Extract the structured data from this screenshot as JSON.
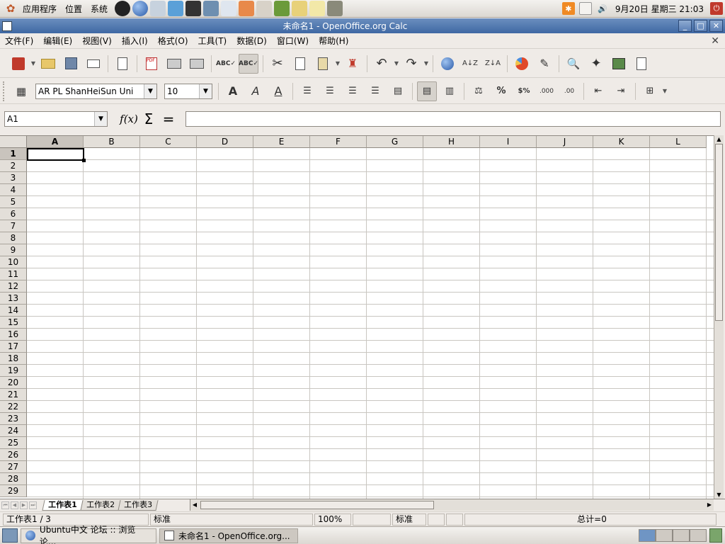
{
  "top_panel": {
    "menus": [
      "应用程序",
      "位置",
      "系统"
    ],
    "clock": "9月20日 星期三 21:03"
  },
  "window": {
    "title": "未命名1 - OpenOffice.org Calc"
  },
  "menubar": {
    "items": [
      "文件(F)",
      "编辑(E)",
      "视图(V)",
      "插入(I)",
      "格式(O)",
      "工具(T)",
      "数据(D)",
      "窗口(W)",
      "帮助(H)"
    ]
  },
  "format_toolbar": {
    "font_name": "AR PL ShanHeiSun Uni",
    "font_size": "10"
  },
  "formula_bar": {
    "name_box": "A1",
    "fx_label": "f(x)",
    "sum_label": "Σ",
    "equals_label": "=",
    "formula_value": ""
  },
  "sheet": {
    "columns": [
      "A",
      "B",
      "C",
      "D",
      "E",
      "F",
      "G",
      "H",
      "I",
      "J",
      "K",
      "L"
    ],
    "rows": [
      "1",
      "2",
      "3",
      "4",
      "5",
      "6",
      "7",
      "8",
      "9",
      "10",
      "11",
      "12",
      "13",
      "14",
      "15",
      "16",
      "17",
      "18",
      "19",
      "20",
      "21",
      "22",
      "23",
      "24",
      "25",
      "26",
      "27",
      "28",
      "29"
    ],
    "active_column": "A",
    "active_row": "1",
    "tabs": [
      "工作表1",
      "工作表2",
      "工作表3"
    ]
  },
  "statusbar": {
    "sheet_pos": "工作表1 / 3",
    "page_style": "标准",
    "zoom": "100%",
    "insert_mode": "标准",
    "sum": "总计=0"
  },
  "taskbar": {
    "tasks": [
      {
        "label": "Ubuntu中文 论坛 :: 浏览论...",
        "active": false
      },
      {
        "label": "未命名1 - OpenOffice.org...",
        "active": true
      }
    ]
  }
}
